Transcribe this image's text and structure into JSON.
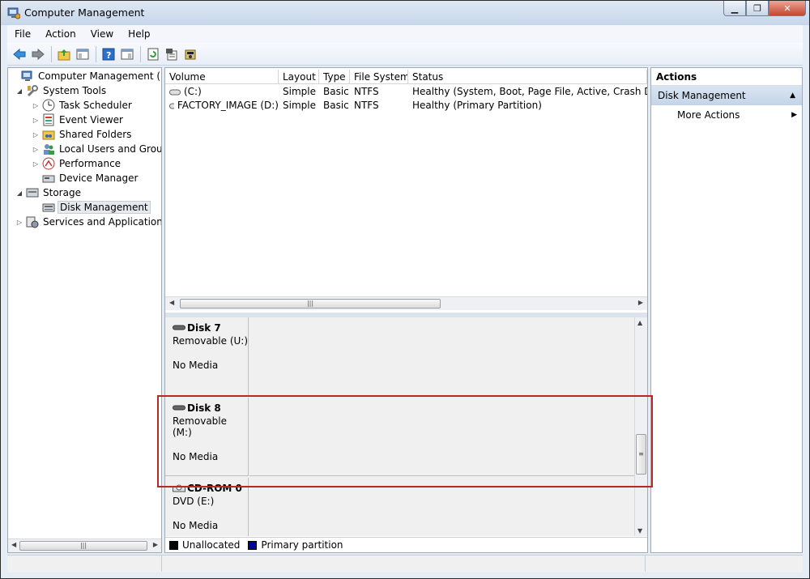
{
  "window": {
    "title": "Computer Management"
  },
  "menu": [
    "File",
    "Action",
    "View",
    "Help"
  ],
  "tree": {
    "items": [
      {
        "label": "Computer Management (Local",
        "icon": "computer-management-icon",
        "indent": 0,
        "expander": ""
      },
      {
        "label": "System Tools",
        "icon": "system-tools-icon",
        "indent": 1,
        "expander": "◢"
      },
      {
        "label": "Task Scheduler",
        "icon": "task-scheduler-icon",
        "indent": 2,
        "expander": "▷"
      },
      {
        "label": "Event Viewer",
        "icon": "event-viewer-icon",
        "indent": 2,
        "expander": "▷"
      },
      {
        "label": "Shared Folders",
        "icon": "shared-folders-icon",
        "indent": 2,
        "expander": "▷"
      },
      {
        "label": "Local Users and Groups",
        "icon": "local-users-icon",
        "indent": 2,
        "expander": "▷"
      },
      {
        "label": "Performance",
        "icon": "performance-icon",
        "indent": 2,
        "expander": "▷"
      },
      {
        "label": "Device Manager",
        "icon": "device-manager-icon",
        "indent": 2,
        "expander": ""
      },
      {
        "label": "Storage",
        "icon": "storage-icon",
        "indent": 1,
        "expander": "◢"
      },
      {
        "label": "Disk Management",
        "icon": "disk-management-icon",
        "indent": 2,
        "expander": "",
        "selected": true
      },
      {
        "label": "Services and Applications",
        "icon": "services-icon",
        "indent": 1,
        "expander": "▷"
      }
    ]
  },
  "volumes": {
    "columns": [
      "Volume",
      "Layout",
      "Type",
      "File System",
      "Status"
    ],
    "rows": [
      [
        "(C:)",
        "Simple",
        "Basic",
        "NTFS",
        "Healthy (System, Boot, Page File, Active, Crash Dump, P"
      ],
      [
        "FACTORY_IMAGE (D:)",
        "Simple",
        "Basic",
        "NTFS",
        "Healthy (Primary Partition)"
      ]
    ]
  },
  "disks": [
    {
      "name": "Disk 7",
      "type": "Removable (U:)",
      "media": "No Media"
    },
    {
      "name": "Disk 8",
      "type": "Removable (M:)",
      "media": "No Media"
    },
    {
      "name": "CD-ROM 0",
      "type": "DVD (E:)",
      "media": "No Media"
    }
  ],
  "legend": [
    {
      "label": "Unallocated",
      "color": "#000000"
    },
    {
      "label": "Primary partition",
      "color": "#0000a0"
    }
  ],
  "actions": {
    "header": "Actions",
    "section": "Disk Management",
    "items": [
      "More Actions"
    ]
  }
}
